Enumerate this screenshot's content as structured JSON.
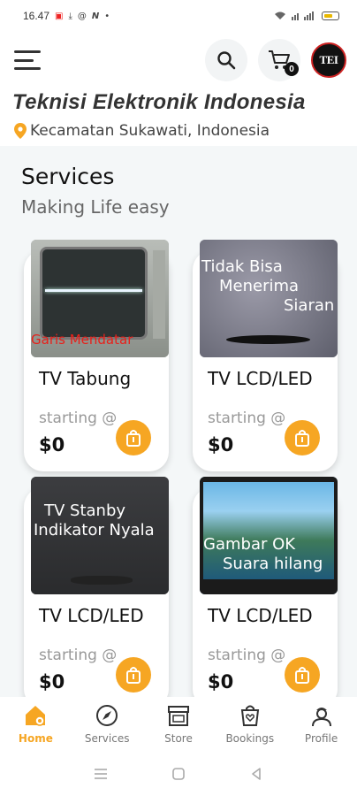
{
  "status_bar": {
    "time": "16.47",
    "icons_left": [
      "notification-icon",
      "download-icon",
      "at-icon",
      "n-icon"
    ],
    "dot": "•"
  },
  "header": {
    "logo_text": "TEI",
    "cart_count": "0",
    "brand_title": "Teknisi Elektronik Indonesia",
    "location": "Kecamatan Sukawati, Indonesia"
  },
  "section": {
    "title": "Services",
    "subtitle": "Making Life easy"
  },
  "services": [
    {
      "name": "TV Tabung",
      "starting": "starting @",
      "price": "$0",
      "image_caption": "Garis Mendatar"
    },
    {
      "name": "TV LCD/LED",
      "starting": "starting @",
      "price": "$0",
      "image_caption_line1": "Tidak Bisa",
      "image_caption_line2": "Menerima",
      "image_caption_line3": "Siaran"
    },
    {
      "name": "TV LCD/LED",
      "starting": "starting @",
      "price": "$0",
      "image_caption_line1": "TV Stanby",
      "image_caption_line2": "Indikator Nyala"
    },
    {
      "name": "TV LCD/LED",
      "starting": "starting @",
      "price": "$0",
      "image_caption_line1": "Gambar OK",
      "image_caption_line2": "Suara hilang"
    }
  ],
  "bottom_nav": [
    {
      "label": "Home",
      "icon": "home-icon",
      "active": true
    },
    {
      "label": "Services",
      "icon": "compass-icon",
      "active": false
    },
    {
      "label": "Store",
      "icon": "store-icon",
      "active": false
    },
    {
      "label": "Bookings",
      "icon": "bookings-icon",
      "active": false
    },
    {
      "label": "Profile",
      "icon": "profile-icon",
      "active": false
    }
  ],
  "colors": {
    "accent": "#f6a623",
    "content_bg": "#f4f7f8"
  }
}
